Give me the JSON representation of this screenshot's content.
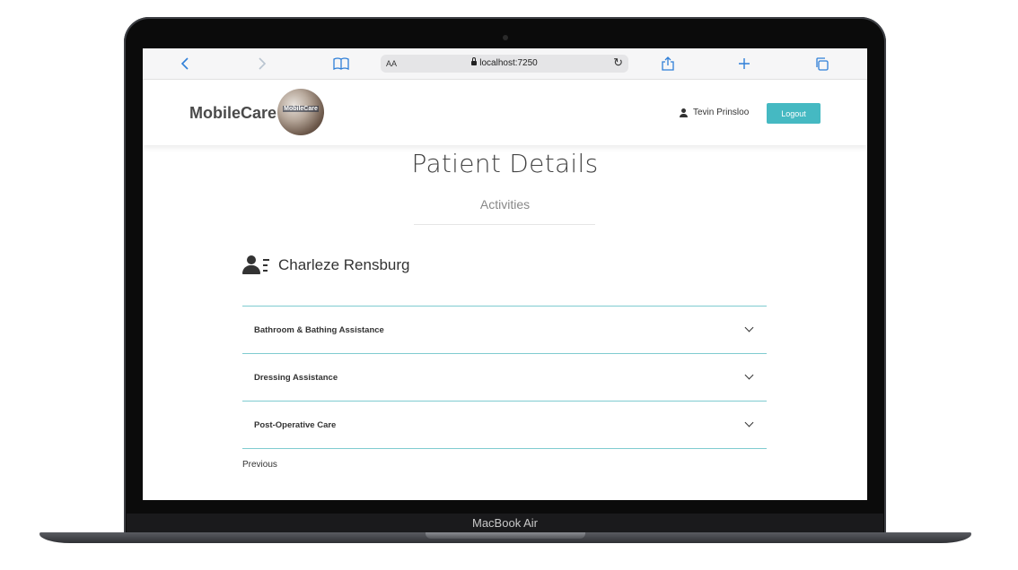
{
  "device": {
    "model_label": "MacBook Air"
  },
  "browser": {
    "reader_label": "AA",
    "url": "localhost:7250"
  },
  "navbar": {
    "brand": "MobileCare",
    "logo_text": "MobileCare",
    "user_name": "Tevin Prinsloo",
    "logout_label": "Logout"
  },
  "page": {
    "title": "Patient Details",
    "subtitle": "Activities"
  },
  "patient": {
    "name": "Charleze Rensburg"
  },
  "activities": [
    {
      "label": "Bathroom & Bathing Assistance"
    },
    {
      "label": "Dressing Assistance"
    },
    {
      "label": "Post-Operative Care"
    }
  ],
  "pagination": {
    "previous_label": "Previous"
  },
  "colors": {
    "accent": "#45b9c2",
    "divider": "#7fcbd0",
    "browser_icon": "#2f7fd8"
  }
}
